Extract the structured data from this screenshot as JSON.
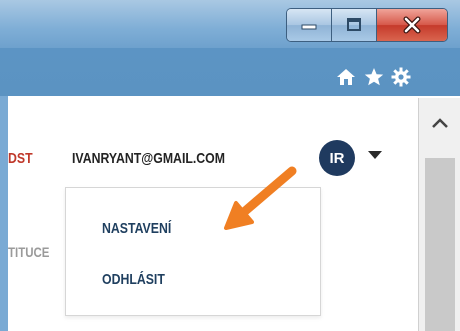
{
  "window": {
    "caption_buttons": {
      "minimize": "minimize",
      "maximize": "maximize",
      "close": "close"
    },
    "toolbar_icons": [
      "home-icon",
      "star-icon",
      "gear-icon"
    ]
  },
  "header": {
    "partial_link": "DST",
    "email": "IVANRYANT@GMAIL.COM",
    "avatar_initials": "IR"
  },
  "menu": {
    "items": [
      "NASTAVENÍ",
      "ODHLÁSIT"
    ]
  },
  "page": {
    "partial_tab": "TITUCE"
  },
  "colors": {
    "accent_red": "#c0392b",
    "avatar_bg": "#1f3a5f",
    "annotation_arrow": "#f07f23"
  }
}
